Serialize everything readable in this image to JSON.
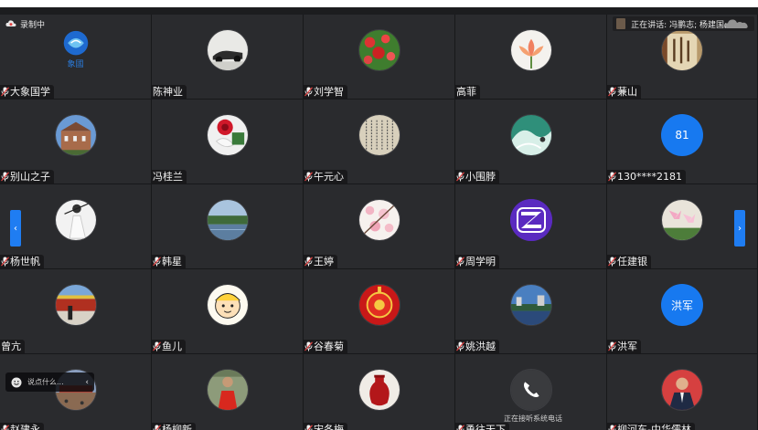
{
  "recording": {
    "label": "录制中"
  },
  "speaking": {
    "label": "正在讲话: 冯鹏志; 杨建国;"
  },
  "chat": {
    "placeholder": "说点什么...",
    "collapse_glyph": "‹"
  },
  "nav": {
    "prev_glyph": "‹",
    "next_glyph": "›"
  },
  "phone_status": "正在接听系统电话",
  "colors": {
    "tile_bg": "#2a2b2e",
    "accent": "#1779f0",
    "muted_mic": "#e14141"
  },
  "participants": [
    {
      "name": "大象国学",
      "muted": true,
      "avatar": "logo-icon",
      "logo_text": "象國"
    },
    {
      "name": "陈神业",
      "muted": false,
      "avatar": "photo-car"
    },
    {
      "name": "刘学智",
      "muted": true,
      "avatar": "photo-flowers-red"
    },
    {
      "name": "高菲",
      "muted": false,
      "avatar": "photo-lotus"
    },
    {
      "name": "蒹山",
      "muted": true,
      "avatar": "photo-calligraphy"
    },
    {
      "name": "别山之子",
      "muted": true,
      "avatar": "photo-building"
    },
    {
      "name": "冯桂兰",
      "muted": false,
      "avatar": "photo-rose"
    },
    {
      "name": "午元心",
      "muted": true,
      "avatar": "photo-manuscript"
    },
    {
      "name": "小围脖",
      "muted": true,
      "avatar": "photo-wave"
    },
    {
      "name": "130****2181",
      "muted": true,
      "avatar": "text",
      "avatar_text": "81"
    },
    {
      "name": "杨世帆",
      "muted": true,
      "avatar": "photo-person-white"
    },
    {
      "name": "韩星",
      "muted": true,
      "avatar": "photo-lake"
    },
    {
      "name": "王婷",
      "muted": true,
      "avatar": "photo-blossom"
    },
    {
      "name": "周学明",
      "muted": true,
      "avatar": "z-logo-icon"
    },
    {
      "name": "任建银",
      "muted": true,
      "avatar": "photo-lilies"
    },
    {
      "name": "曾亢",
      "muted": false,
      "avatar": "photo-gate"
    },
    {
      "name": "鱼儿",
      "muted": true,
      "avatar": "photo-cartoon"
    },
    {
      "name": "谷春菊",
      "muted": true,
      "avatar": "photo-red-ornament"
    },
    {
      "name": "姚洪越",
      "muted": true,
      "avatar": "photo-cityscape"
    },
    {
      "name": "洪军",
      "muted": true,
      "avatar": "text",
      "avatar_text": "洪军"
    },
    {
      "name": "赵建永",
      "muted": true,
      "avatar": "photo-plaza"
    },
    {
      "name": "杨柳新",
      "muted": true,
      "avatar": "photo-man-red"
    },
    {
      "name": "宋冬梅",
      "muted": true,
      "avatar": "photo-vase"
    },
    {
      "name": "勇往天下",
      "muted": true,
      "avatar": "phone-icon"
    },
    {
      "name": "柳河东-中华儒林",
      "muted": true,
      "avatar": "photo-man-suit"
    }
  ]
}
